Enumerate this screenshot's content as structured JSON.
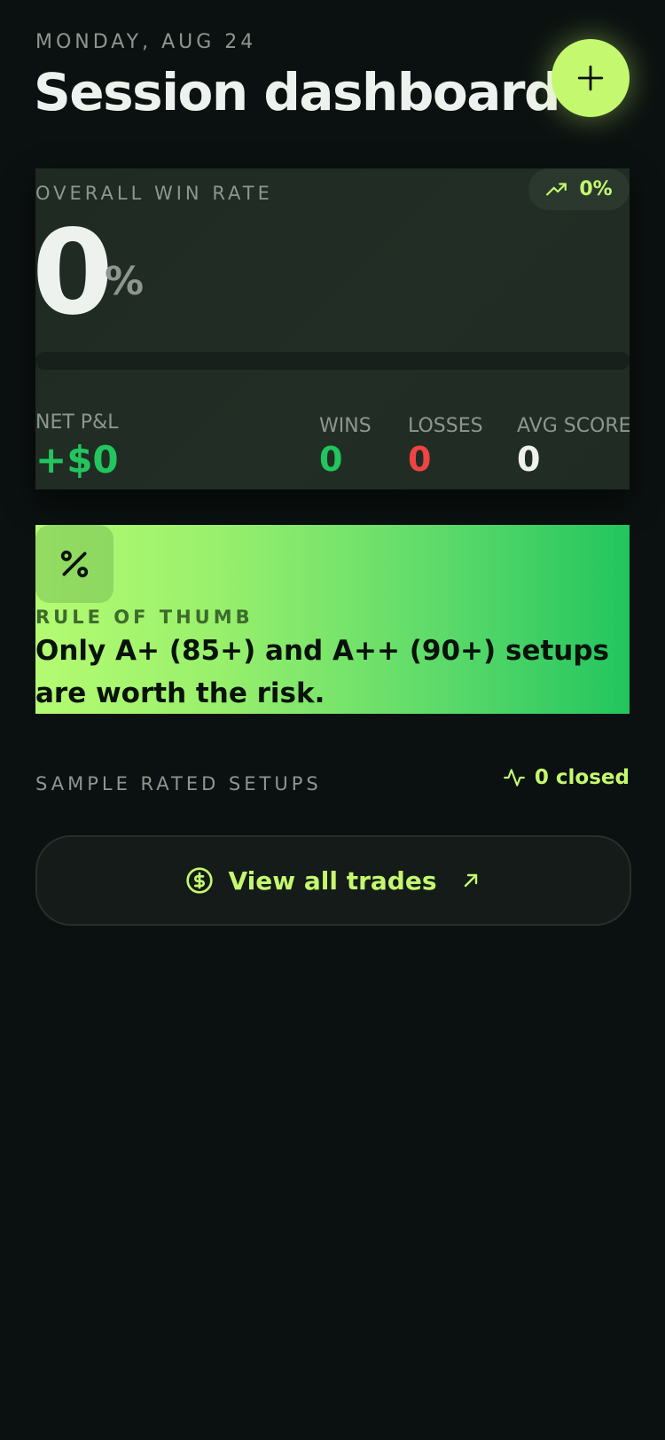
{
  "header": {
    "date": "MONDAY, AUG 24",
    "title": "Session dashboard",
    "add_icon": "plus-icon"
  },
  "win_rate_card": {
    "label": "OVERALL WIN RATE",
    "trend": {
      "icon": "trending-up-icon",
      "value": "0%"
    },
    "rate_value": "0",
    "rate_unit": "%",
    "progress_fraction": 0,
    "net_pnl": {
      "label": "NET P&L",
      "value": "+$0"
    },
    "stats": [
      {
        "label": "WINS",
        "value": "0"
      },
      {
        "label": "LOSSES",
        "value": "0"
      },
      {
        "label": "AVG SCORE",
        "value": "0"
      }
    ]
  },
  "rule_card": {
    "icon": "percent-icon",
    "label": "RULE OF THUMB",
    "text": "Only A+ (85+) and A++ (90+) setups are worth the risk."
  },
  "setups": {
    "label": "SAMPLE RATED SETUPS",
    "closed_icon": "activity-icon",
    "closed_text": "0 closed"
  },
  "view_all": {
    "icon": "dollar-coin-icon",
    "label": "View all trades",
    "arrow_icon": "arrow-up-right-icon"
  },
  "colors": {
    "background": "#0b1110",
    "accent": "#c4f86f",
    "win": "#22c55e",
    "loss": "#ef4444",
    "muted": "#8e968f"
  }
}
